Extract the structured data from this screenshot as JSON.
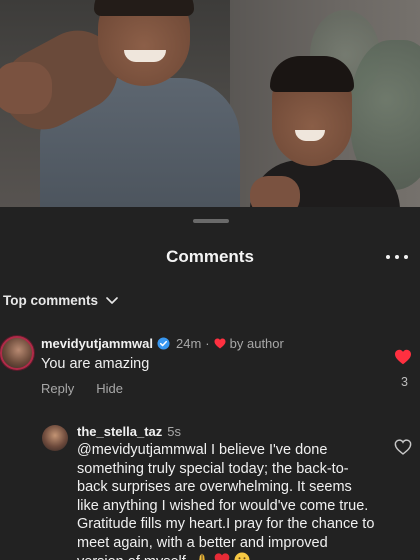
{
  "sheet": {
    "title": "Comments",
    "sort_label": "Top comments"
  },
  "comments": [
    {
      "username": "mevidyutjammwal",
      "time": "24m",
      "separator": "·",
      "author_badge": "by author",
      "text": "You are amazing",
      "reply_label": "Reply",
      "hide_label": "Hide",
      "like_count": "3",
      "liked": true
    },
    {
      "username": "the_stella_taz",
      "time": "5s",
      "text": "@mevidyutjammwal I believe I've done something truly special today; the back-to-back surprises are overwhelming. It seems like anything I wished for would've come true. Gratitude fills my heart.I pray for the chance to meet again, with a better and improved version of myself.",
      "emojis": [
        "folded-hands",
        "red-heart",
        "smiling-face"
      ],
      "liked": false
    }
  ],
  "colors": {
    "accent_like": "#ff3040",
    "verified": "#3897f0",
    "sheet_bg": "#222222"
  },
  "icons": [
    "more-horizontal-icon",
    "chevron-down-icon",
    "verified-badge-icon",
    "heart-icon"
  ]
}
